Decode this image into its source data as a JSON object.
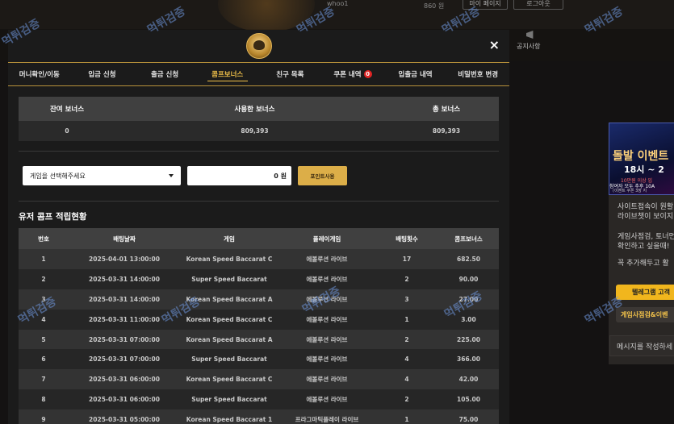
{
  "background": {
    "user_name": "whoo1",
    "balance": "860 원",
    "mypage_label": "마이 페이지",
    "logout_label": "로그아웃",
    "nav_item": "공지사항",
    "watermark": "먹튀검증"
  },
  "side_panel": {
    "banner_title": "돌발 이벤트",
    "banner_time": "18시 ~ 2",
    "banner_line1": "10만원 이상 입",
    "banner_line2": "참여자 모두 추후 10A",
    "banner_line3": "(이벤트 쿠폰 3장 지",
    "text1": "사이트접속이 원활",
    "text2": "라이브챗이 보이지",
    "text3": "게임사점검, 토너먼",
    "text4": "확인하고 싶을때!",
    "text5": "꼭 추가해두고 활",
    "telegram_button": "텔레그램 고객",
    "notice_button": "게임사점검&이벤",
    "message_placeholder": "메시지를 작성하세"
  },
  "modal": {
    "close": "×",
    "tabs": [
      {
        "label": "머니확인/이동"
      },
      {
        "label": "입금 신청"
      },
      {
        "label": "출금 신청"
      },
      {
        "label": "콤프보너스"
      },
      {
        "label": "친구 목록"
      },
      {
        "label": "쿠폰 내역",
        "badge": "0"
      },
      {
        "label": "입출금 내역"
      },
      {
        "label": "비밀번호 변경"
      }
    ],
    "active_tab": "콤프보너스",
    "bonus_summary": {
      "headers": [
        "잔여 보너스",
        "사용한 보너스",
        "총 보너스"
      ],
      "values": [
        "0",
        "809,393",
        "809,393"
      ]
    },
    "game_select": "게임을 선택해주세요",
    "amount_value": "0 원",
    "use_points_button": "포인트사용",
    "section_title": "유저 콤프 적립현황",
    "history": {
      "headers": [
        "번호",
        "배팅날짜",
        "게임",
        "플레이게임",
        "배팅횟수",
        "콤프보너스"
      ],
      "rows": [
        [
          "1",
          "2025-04-01 13:00:00",
          "Korean Speed Baccarat C",
          "에볼루션 라이브",
          "17",
          "682.50"
        ],
        [
          "2",
          "2025-03-31 14:00:00",
          "Super Speed Baccarat",
          "에볼루션 라이브",
          "2",
          "90.00"
        ],
        [
          "3",
          "2025-03-31 14:00:00",
          "Korean Speed Baccarat A",
          "에볼루션 라이브",
          "3",
          "27.00"
        ],
        [
          "4",
          "2025-03-31 11:00:00",
          "Korean Speed Baccarat C",
          "에볼루션 라이브",
          "1",
          "3.00"
        ],
        [
          "5",
          "2025-03-31 07:00:00",
          "Korean Speed Baccarat A",
          "에볼루션 라이브",
          "2",
          "225.00"
        ],
        [
          "6",
          "2025-03-31 07:00:00",
          "Super Speed Baccarat",
          "에볼루션 라이브",
          "4",
          "366.00"
        ],
        [
          "7",
          "2025-03-31 06:00:00",
          "Korean Speed Baccarat C",
          "에볼루션 라이브",
          "4",
          "42.00"
        ],
        [
          "8",
          "2025-03-31 06:00:00",
          "Super Speed Baccarat",
          "에볼루션 라이브",
          "2",
          "105.00"
        ],
        [
          "9",
          "2025-03-31 05:00:00",
          "Korean Speed Baccarat 1",
          "프라그마틱플레이 라이브",
          "1",
          "75.00"
        ]
      ]
    }
  }
}
